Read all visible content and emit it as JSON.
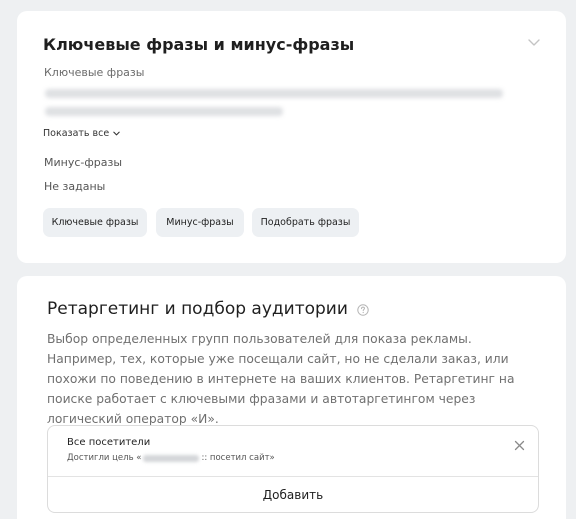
{
  "keywords_card": {
    "title": "Ключевые фразы и минус-фразы",
    "keywords_label": "Ключевые фразы",
    "show_all_label": "Показать все",
    "minus_label": "Минус-фразы",
    "minus_value": "Не заданы",
    "buttons": {
      "keywords": "Ключевые фразы",
      "minus": "Минус-фразы",
      "pick": "Подобрать фразы"
    }
  },
  "retargeting_card": {
    "title": "Ретаргетинг и подбор аудитории",
    "description": "Выбор определенных групп пользователей для показа рекламы. Например, тех, которые уже посещали сайт, но не сделали заказ, или похожи по поведению в интернете на ваших клиентов. Ретаргетинг на поиске работает с ключевыми фразами и автотаргетингом через логический оператор «И».",
    "audience": {
      "title": "Все посетители",
      "subtitle_prefix": "Достигли цель «",
      "subtitle_suffix": ":: посетил сайт»"
    },
    "add_label": "Добавить"
  },
  "icons": [
    "chevron-down-icon",
    "question-icon",
    "close-icon"
  ],
  "colors": {
    "background": "#eef0f2",
    "card": "#ffffff",
    "pill": "#edf0f3",
    "muted_text": "#707070"
  }
}
